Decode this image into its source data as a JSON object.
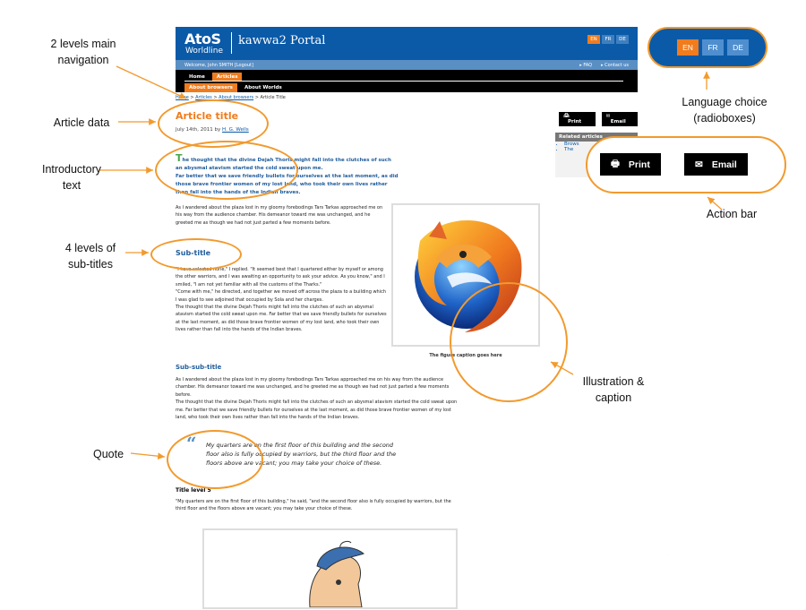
{
  "header": {
    "logo_brand": "AtoS",
    "logo_sub": "Worldline",
    "portal": "kawwa2 Portal",
    "lang_mini": [
      "EN",
      "FR",
      "DE"
    ],
    "welcome": "Welcome, John SMITH [Logout]",
    "links": [
      "▸ FAQ",
      "▸ Contact us"
    ]
  },
  "nav": {
    "level1": [
      "Home",
      "Articles"
    ],
    "level2": [
      "About browsers",
      "About Worlds"
    ]
  },
  "breadcrumb": [
    "Home",
    "Articles",
    "About browsers",
    "Article Title"
  ],
  "article": {
    "title": "Article title",
    "date": "July 14th, 2011 by",
    "author": "H. G. Wells",
    "intro_cap": "T",
    "intro": "he thought that the divine Dejah Thoris might fall into the clutches of such an abysmal atavism started the cold sweat upon me.\n   Far better that we save friendly bullets for ourselves at the last moment, as did those brave frontier women of my lost land, who took their own lives rather than fall into the hands of the Indian braves.",
    "para1": "As I wandered about the plaza lost in my gloomy forebodings Tars Tarkas approached me on his way from the audience chamber. His demeanor toward me was unchanged, and he greeted me as though we had not just parted a few moments before.",
    "subtitle": "Sub-title",
    "para2": "\"I have selected none,\" I replied. \"It seemed best that I quartered either by myself or among the other warriors, and I was awaiting an opportunity to ask your advice. As you know,\" and I smiled, \"I am not yet familiar with all the customs of the Tharks.\"\n   \"Come with me,\" he directed, and together we moved off across the plaza to a building which I was glad to see adjoined that occupied by Sola and her charges.\n   The thought that the divine Dejah Thoris might fall into the clutches of such an abysmal atavism started the cold sweat upon me. Far better that we save friendly bullets for ourselves at the last moment, as did those brave frontier women of my lost land, who took their own lives rather than fall into the hands of the Indian braves.",
    "subsubtitle": "Sub-sub-title",
    "para3": "As I wandered about the plaza lost in my gloomy forebodings Tars Tarkas approached me on his way from the audience chamber. His demeanor toward me was unchanged, and he greeted me as though we had not just parted a few moments before.\n   The thought that the divine Dejah Thoris might fall into the clutches of such an abysmal atavism started the cold sweat upon me. Far better that we save friendly bullets for ourselves at the last moment, as did those brave frontier women of my lost land, who took their own lives rather than fall into the hands of the Indian braves.",
    "figure_caption": "The figure caption goes here",
    "quote": "My quarters are on the first floor of this building and the second floor also is fully occupied by warriors, but the third floor and the floors above are vacant; you may take your choice of these.",
    "title5": "Title level 5",
    "para4": "\"My quarters are on the first floor of this building,\" he said, \"and the second floor also is fully occupied by warriors, but the third floor and the floors above are vacant; you may take your choice of these."
  },
  "sidebar": {
    "print": "Print",
    "email": "Email",
    "related_title": "Related articles",
    "related": [
      "Brows",
      "The"
    ]
  },
  "callouts": {
    "nav": "2 levels main\nnavigation",
    "article_data": "Article data",
    "intro": "Introductory\ntext",
    "subtitles": "4 levels of\nsub-titles",
    "quote": "Quote",
    "language": "Language choice\n(radioboxes)",
    "action": "Action bar",
    "illustration": "Illustration &\ncaption"
  },
  "language_buttons": [
    "EN",
    "FR",
    "DE"
  ],
  "action_buttons": {
    "print": "Print",
    "email": "Email"
  },
  "colors": {
    "brand_blue": "#0a5aa8",
    "orange": "#f07c1e",
    "annotation": "#f29a2e"
  }
}
